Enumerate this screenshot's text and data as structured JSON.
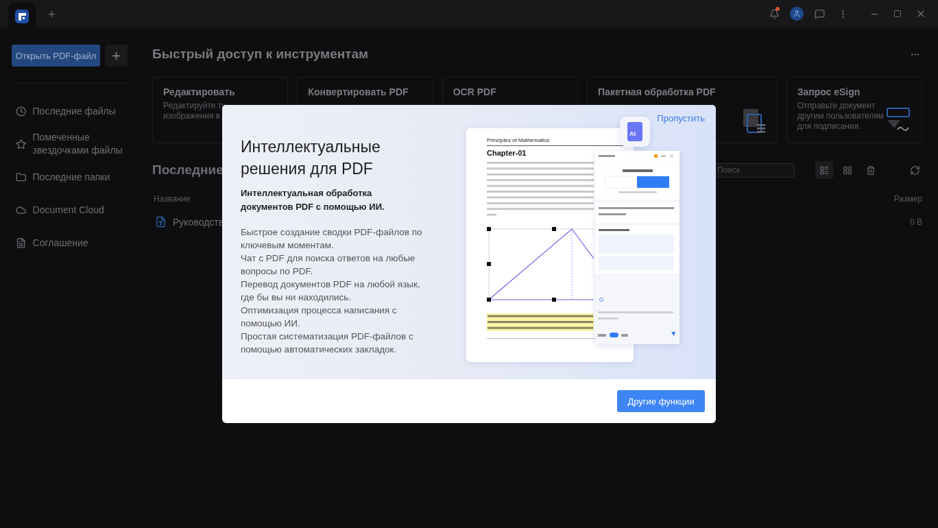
{
  "sidebar": {
    "open_button": "Открыть PDF-файл",
    "items": [
      {
        "kind": "recent",
        "label": "Последние файлы"
      },
      {
        "kind": "star",
        "label": "Помеченные звездочками файлы"
      },
      {
        "kind": "folder",
        "label": "Последние папки"
      },
      {
        "kind": "cloud",
        "label": "Document Cloud"
      },
      {
        "kind": "doc",
        "label": "Соглашение"
      }
    ]
  },
  "main": {
    "title": "Быстрый доступ к инструментам",
    "tools": [
      {
        "kind": "edit",
        "title": "Редактировать",
        "description": [
          "Редактируйте те",
          "изображения в"
        ]
      },
      {
        "kind": "convert",
        "title": "Конвертировать PDF"
      },
      {
        "kind": "ocr",
        "title": "OCR PDF"
      },
      {
        "kind": "batch",
        "title": "Пакетная обработка PDF"
      },
      {
        "kind": "esign",
        "title": "Запрос eSign",
        "description": [
          "Отправьте документ",
          "другим пользователям",
          "для подписания."
        ]
      }
    ],
    "recent_title": "Последние",
    "search": {
      "placeholder": "Поиск"
    },
    "view_buttons": [
      {
        "kind": "list",
        "selected": true
      },
      {
        "kind": "grid",
        "selected": false
      },
      {
        "kind": "trash",
        "selected": false
      }
    ],
    "columns": [
      "Название",
      "Размер"
    ],
    "rows": [
      {
        "name": "Руководств",
        "size": "0 B"
      }
    ]
  },
  "modal": {
    "skip": "Пропустить",
    "title": "Интеллектуальные решения для PDF",
    "subtitle": "Интеллектуальная обработка документов PDF с помощью ИИ.",
    "features": [
      "Быстрое создание сводки PDF-файлов по ключевым моментам.",
      "Чат с PDF для поиска ответов на любые вопросы по PDF.",
      "Перевод документов PDF на любой язык, где бы вы ни находились.",
      "Оптимизация процесса написания с помощью ИИ.",
      "Простая систематизация PDF-файлов с помощью автоматических закладок."
    ],
    "button": "Другие функции",
    "illustration": {
      "header": "Principles of Mathematics",
      "chapter": "Chapter-01",
      "ai_badge": "AI"
    }
  }
}
